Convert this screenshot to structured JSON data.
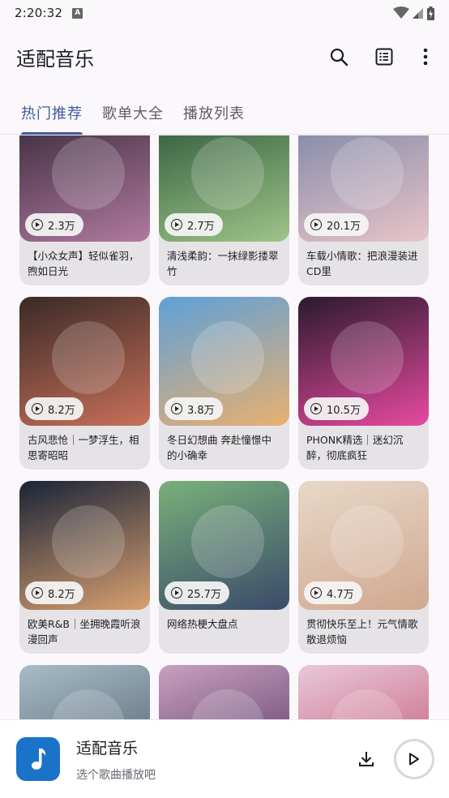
{
  "status": {
    "time": "2:20:32",
    "notification_badge": "A"
  },
  "appbar": {
    "title": "适配音乐",
    "icons": [
      "search-icon",
      "list-icon",
      "more-vert-icon"
    ]
  },
  "tabs": [
    {
      "label": "热门推荐",
      "active": true
    },
    {
      "label": "歌单大全",
      "active": false
    },
    {
      "label": "播放列表",
      "active": false
    }
  ],
  "cards": [
    {
      "plays": "2.3万",
      "title": "【小众女声】轻似雀羽，煦如日光",
      "colors": [
        "#3a2a3a",
        "#b07aa0"
      ]
    },
    {
      "plays": "2.7万",
      "title": "清浅柔韵：一抹绿影搂翠竹",
      "colors": [
        "#2f5a3a",
        "#9fc48a"
      ]
    },
    {
      "plays": "20.1万",
      "title": "车载小情歌：把浪漫装进CD里",
      "colors": [
        "#7c86a8",
        "#e8c4c8"
      ]
    },
    {
      "plays": "8.2万",
      "title": "古风悲怆｜一梦浮生，相思寄昭昭",
      "colors": [
        "#3a2a26",
        "#c8705a"
      ]
    },
    {
      "plays": "3.8万",
      "title": "冬日幻想曲 奔赴憧憬中的小确幸",
      "colors": [
        "#5fa0d8",
        "#e8b070"
      ]
    },
    {
      "plays": "10.5万",
      "title": "PHONK精选｜迷幻沉醉，彻底疯狂",
      "colors": [
        "#2a1a2e",
        "#e84aa0"
      ]
    },
    {
      "plays": "8.2万",
      "title": "欧美R&B｜坐拥晚霞听浪漫回声",
      "colors": [
        "#1a2438",
        "#d8a070"
      ]
    },
    {
      "plays": "25.7万",
      "title": "网络热梗大盘点",
      "colors": [
        "#7ab07a",
        "#3a4a6a"
      ]
    },
    {
      "plays": "4.7万",
      "title": "贯彻快乐至上！元气情歌散退烦恼",
      "colors": [
        "#e8d8c8",
        "#d0a890"
      ]
    },
    {
      "plays": "",
      "title": "",
      "colors": [
        "#a8bcc8",
        "#4a5a68"
      ]
    },
    {
      "plays": "",
      "title": "",
      "colors": [
        "#c8a0c0",
        "#503060"
      ]
    },
    {
      "plays": "",
      "title": "",
      "colors": [
        "#e8c8d8",
        "#c05070"
      ]
    }
  ],
  "player": {
    "title": "适配音乐",
    "subtitle": "选个歌曲播放吧"
  }
}
